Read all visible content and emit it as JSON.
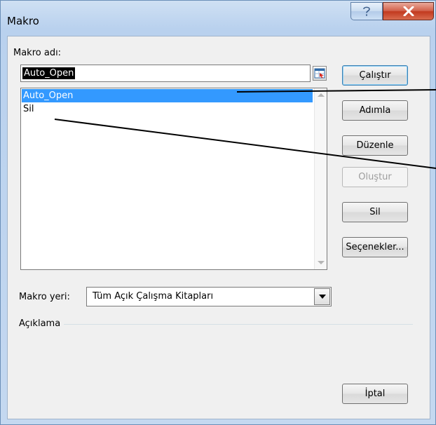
{
  "window": {
    "title": "Makro",
    "help_icon": "help-icon",
    "close_icon": "close-icon"
  },
  "macro_name": {
    "label": "Makro adı:",
    "value": "Auto_Open",
    "ref_icon": "collapse-dialog-icon"
  },
  "macro_list": {
    "items": [
      {
        "label": "Auto_Open",
        "selected": true
      },
      {
        "label": "Sil",
        "selected": false
      }
    ]
  },
  "buttons": {
    "run": "Çalıştır",
    "step": "Adımla",
    "edit": "Düzenle",
    "create": "Oluştur",
    "delete": "Sil",
    "options": "Seçenekler...",
    "cancel": "İptal"
  },
  "macro_location": {
    "label": "Makro yeri:",
    "value": "Tüm Açık Çalışma Kitapları"
  },
  "description": {
    "label": "Açıklama"
  },
  "colors": {
    "selection": "#3399ff",
    "close_button": "#c2391f",
    "title_bar": "#b9d1ee"
  }
}
